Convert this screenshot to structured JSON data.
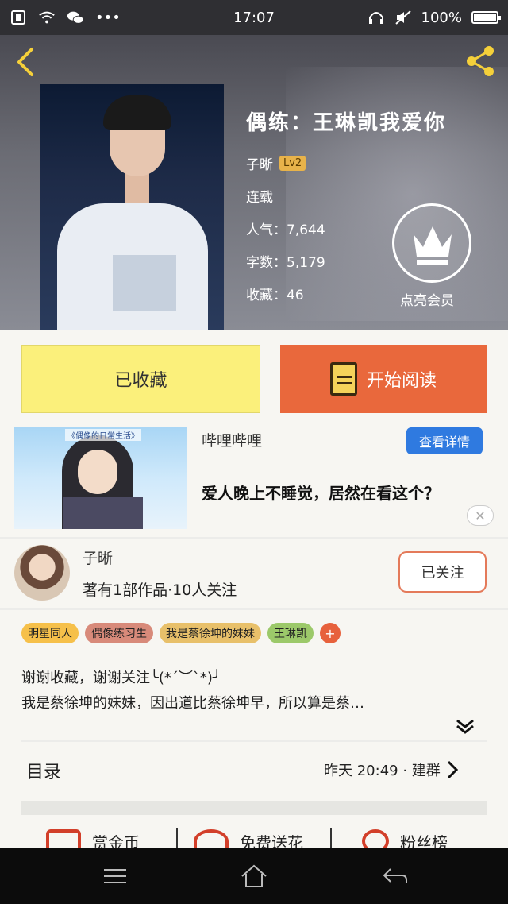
{
  "status_bar": {
    "time": "17:07",
    "battery": "100%",
    "battery_level": 1.0,
    "left_icons": [
      "notification-icon",
      "wifi-icon",
      "wechat-icon",
      "more-dots-icon"
    ],
    "right_icons": [
      "headset-icon",
      "mute-icon",
      "battery-icon"
    ]
  },
  "header": {
    "title": "偶练：王琳凯我爱你",
    "author": "子晰",
    "level": "Lv2",
    "status": "连载",
    "popularity": "人气：7,644",
    "word_count": "字数：5,179",
    "favorites": "收藏：46",
    "vip_label": "点亮会员"
  },
  "buttons": {
    "favorited": "已收藏",
    "start_reading": "开始阅读"
  },
  "ad": {
    "image_caption": "《偶像的日常生活》",
    "source": "哔哩哔哩",
    "detail_button": "查看详情",
    "text": "爱人晚上不睡觉，居然在看这个？",
    "close": "✕"
  },
  "author_card": {
    "name": "子晰",
    "meta": "著有1部作品·10人关注",
    "follow_button": "已关注"
  },
  "tags": [
    {
      "label": "明星同人",
      "color": "#f6c04a"
    },
    {
      "label": "偶像练习生",
      "color": "#d88a7a"
    },
    {
      "label": "我是蔡徐坤的妹妹",
      "color": "#e8c06a"
    },
    {
      "label": "王琳凯",
      "color": "#9cc96a"
    }
  ],
  "tag_add": "+",
  "description": {
    "line1": "谢谢收藏，谢谢关注╰(*´︶`*)╯",
    "line2": "我是蔡徐坤的妹妹，因出道比蔡徐坤早，所以算是蔡…"
  },
  "toc": {
    "label": "目录",
    "latest": "昨天 20:49 · 建群"
  },
  "actions": [
    {
      "label": "赏金币",
      "icon": "envelope-icon"
    },
    {
      "label": "免费送花",
      "icon": "flower-icon"
    },
    {
      "label": "粉丝榜",
      "icon": "ranking-icon"
    }
  ],
  "colors": {
    "accent_orange": "#e9683c",
    "favorited_yellow": "#fbf07b",
    "detail_blue": "#2f7ae0",
    "icon_yellow": "#f5d03a"
  }
}
